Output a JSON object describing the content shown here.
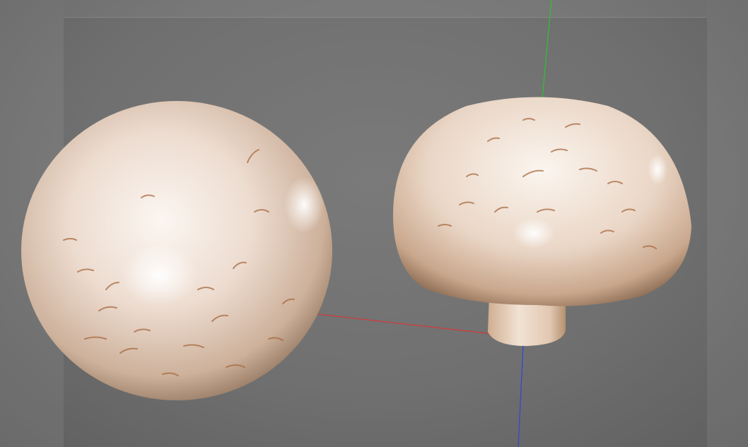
{
  "viewport": {
    "background": "#707070",
    "safe_frame_tint": "rgba(255,255,255,0.07)"
  },
  "axes": {
    "x_color": "#d23a3a",
    "y_color": "#2fc22f",
    "z_color": "#3344d8"
  },
  "objects": [
    {
      "name": "mushroom-cap-top-view",
      "kind": "cap"
    },
    {
      "name": "mushroom-side-view",
      "kind": "cap-with-stem"
    }
  ],
  "material": {
    "base": "#efe6de",
    "highlight": "#ffffff",
    "shadow": "#9a7b62",
    "scratch": "#a86a3f"
  }
}
